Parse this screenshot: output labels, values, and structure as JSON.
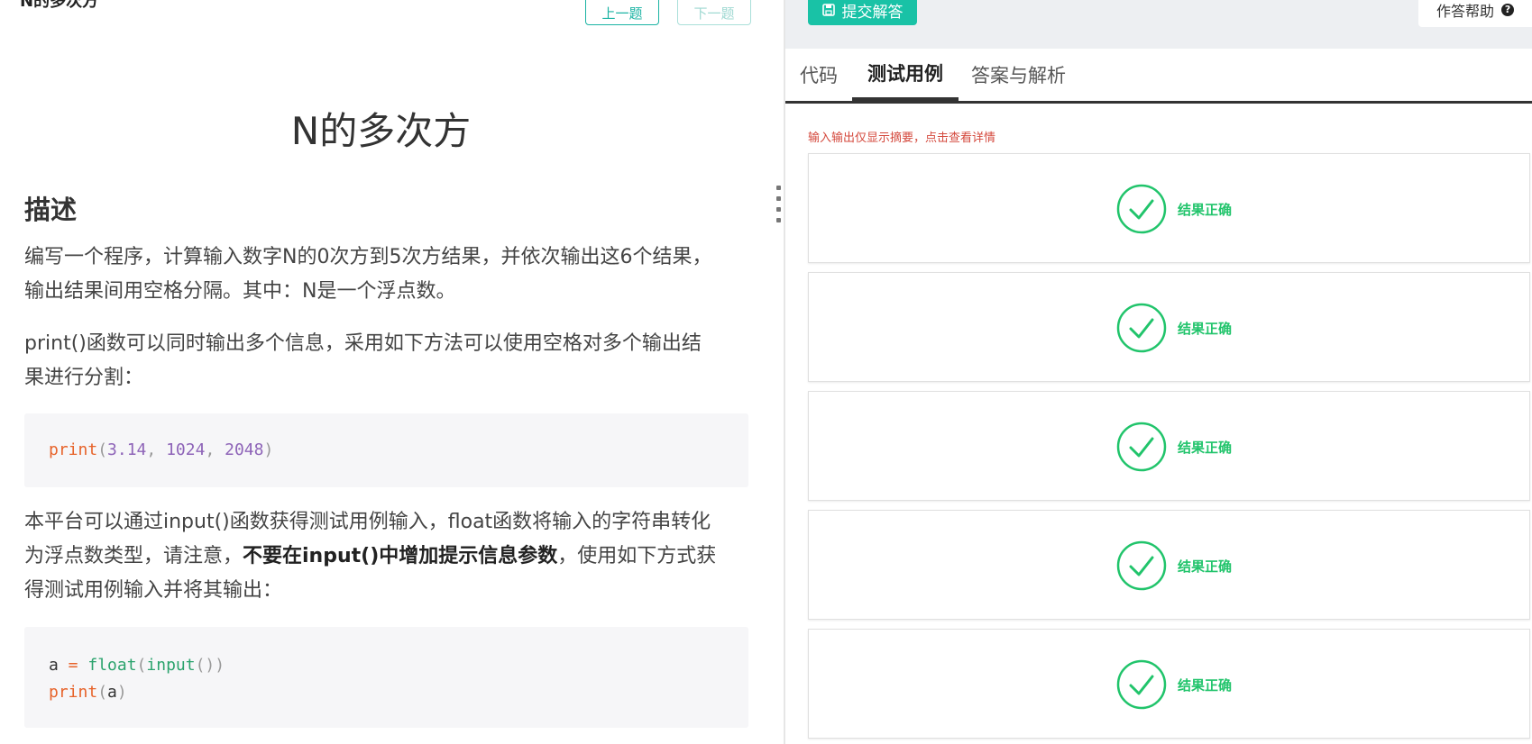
{
  "left": {
    "header_title": "N的多次方",
    "prev_label": "上一题",
    "next_label": "下一题",
    "page_title": "N的多次方",
    "section_heading": "描述",
    "para1_a": "编写一个程序，计算输入数字N的0次方到5次方结果，并依次输出这6个结果，",
    "para1_b": "输出结果间用空格分隔。其中：N是一个浮点数。",
    "para2_a": "print()函数可以同时输出多个信息，采用如下方法可以使用空格对多个输出结",
    "para2_b": "果进行分割：",
    "code1": {
      "fn": "print",
      "open": "(",
      "n1": "3.14",
      "sep1": ", ",
      "n2": "1024",
      "sep2": ", ",
      "n3": "2048",
      "close": ")"
    },
    "para3_a": "本平台可以通过input()函数获得测试用例输入，float函数将输入的字符串转化",
    "para3_b_pre": "为浮点数类型，请注意，",
    "para3_b_bold": "不要在input()中增加提示信息参数",
    "para3_b_post": "，使用如下方式获",
    "para3_c": "得测试用例输入并将其输出：",
    "code2": {
      "line1_var": "a",
      "line1_op": " = ",
      "line1_call": "float",
      "line1_open": "(",
      "line1_inner": "input",
      "line1_parens": "())",
      "line2_fn": "print",
      "line2_open": "(",
      "line2_arg": "a",
      "line2_close": ")"
    }
  },
  "right": {
    "submit_label": "提交解答",
    "help_label": "作答帮助",
    "help_icon": "?",
    "tabs": [
      "代码",
      "测试用例",
      "答案与解析"
    ],
    "active_tab": "测试用例",
    "notice": "输入输出仅显示摘要，点击查看详情",
    "cases": [
      {
        "status": "结果正确"
      },
      {
        "status": "结果正确"
      },
      {
        "status": "结果正确"
      },
      {
        "status": "结果正确"
      },
      {
        "status": "结果正确"
      }
    ],
    "success_color": "#21c46b",
    "accent_color": "#19c2a6"
  }
}
